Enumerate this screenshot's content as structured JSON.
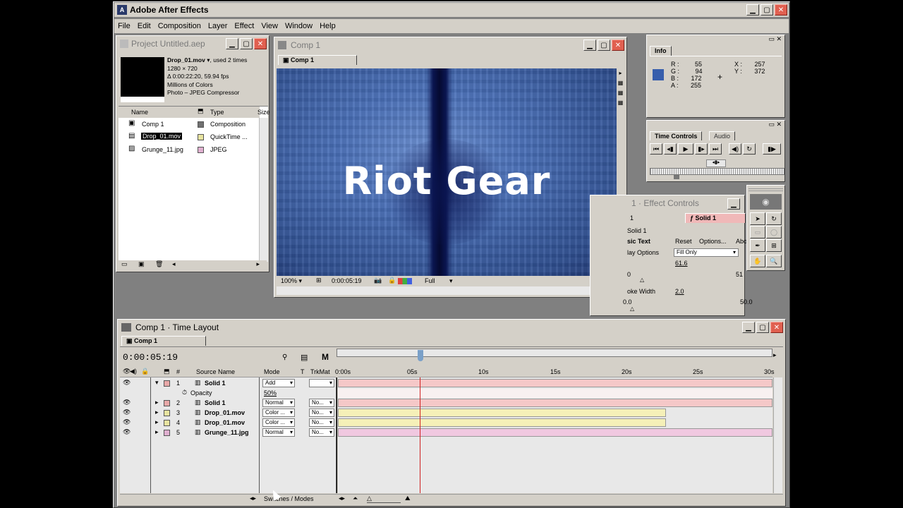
{
  "app": {
    "title": "Adobe After Effects",
    "menu": [
      "File",
      "Edit",
      "Composition",
      "Layer",
      "Effect",
      "View",
      "Window",
      "Help"
    ]
  },
  "project": {
    "title": "Project Untitled.aep",
    "info": {
      "name": "Drop_01.mov",
      "used": ", used 2 times",
      "dims": "1280 × 720",
      "duration": "Δ 0:00:22:20, 59.94 fps",
      "colors": "Millions of Colors",
      "codec": "Photo – JPEG Compressor"
    },
    "columns": {
      "name": "Name",
      "type": "Type",
      "size": "Size"
    },
    "items": [
      {
        "name": "Comp 1",
        "type": "Composition",
        "color": "#707070"
      },
      {
        "name": "Drop_01.mov",
        "type": "QuickTime ...",
        "color": "#e8e4a0"
      },
      {
        "name": "Grunge_11.jpg",
        "type": "JPEG",
        "color": "#e0b0d0"
      }
    ]
  },
  "comp": {
    "title": "Comp 1",
    "tab": "Comp 1",
    "overlay_text": "Riot Gear",
    "zoom": "100%",
    "timecode": "0:00:05:19",
    "resolution": "Full"
  },
  "info_panel": {
    "tab": "Info",
    "r_label": "R :",
    "r": "55",
    "g_label": "G :",
    "g": "94",
    "b_label": "B :",
    "b": "172",
    "a_label": "A :",
    "a": "255",
    "x_label": "X :",
    "x": "257",
    "y_label": "Y :",
    "y": "372",
    "swatch": "#375eac"
  },
  "time_controls": {
    "tab1": "Time Controls",
    "tab2": "Audio"
  },
  "effect_controls": {
    "title": "1 · Effect Controls",
    "tab_left": "1",
    "tab": "Solid 1",
    "layer": "Solid 1",
    "effect": "sic Text",
    "reset": "Reset",
    "options": "Options...",
    "about": "Abo",
    "display_label": "lay Options",
    "display_value": "Fill Only",
    "val1": "61.6",
    "slider1_min": "0",
    "slider1_max": "51",
    "stroke_label": "oke Width",
    "stroke_val": "2.0",
    "slider2_min": "0.0",
    "slider2_max": "50.0"
  },
  "timeline": {
    "title": "Comp 1 · Time Layout",
    "tab": "Comp 1",
    "timecode": "0:00:05:19",
    "m_label": "M",
    "columns": {
      "num": "#",
      "source": "Source Name",
      "mode": "Mode",
      "t": "T",
      "trkmat": "TrkMat"
    },
    "ruler": [
      "0:00s",
      "05s",
      "10s",
      "15s",
      "20s",
      "25s",
      "30s"
    ],
    "layers": [
      {
        "num": "1",
        "name": "Solid 1",
        "mode": "Add",
        "trkmat": "",
        "color": "#e8a8a8",
        "bar": "#f5c8c8",
        "end": 1
      },
      {
        "num": "2",
        "name": "Solid 1",
        "mode": "Normal",
        "trkmat": "No...",
        "color": "#e8a8a8",
        "bar": "#f5c8c8",
        "end": 1
      },
      {
        "num": "3",
        "name": "Drop_01.mov",
        "mode": "Color ...",
        "trkmat": "No...",
        "color": "#e8e4a0",
        "bar": "#f5f0b8",
        "end": 0.755
      },
      {
        "num": "4",
        "name": "Drop_01.mov",
        "mode": "Color ...",
        "trkmat": "No...",
        "color": "#e8e4a0",
        "bar": "#f5f0b8",
        "end": 0.755
      },
      {
        "num": "5",
        "name": "Grunge_11.jpg",
        "mode": "Normal",
        "trkmat": "No...",
        "color": "#e0b0d0",
        "bar": "#f0c8e0",
        "end": 1
      }
    ],
    "opacity_label": "Opacity",
    "opacity_value": "50%",
    "switches_label": "Switches / Modes"
  }
}
